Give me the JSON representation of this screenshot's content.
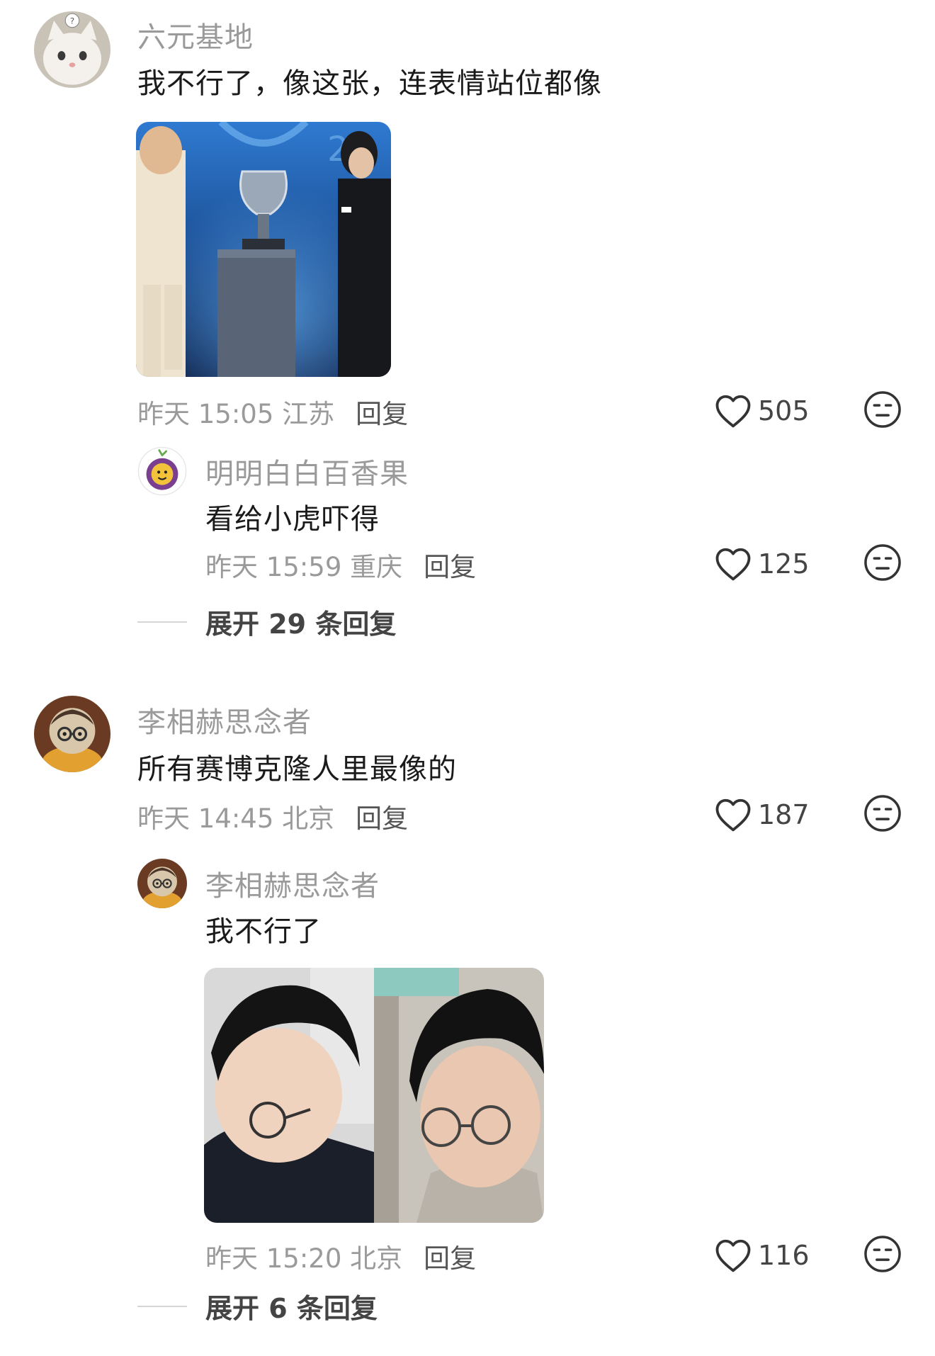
{
  "comments": [
    {
      "username": "六元基地",
      "text": "我不行了，像这张，连表情站位都像",
      "time": "昨天 15:05 江苏",
      "reply_label": "回复",
      "likes": "505",
      "avatar_icon": "cat-avatar-icon",
      "image": "trophy-stage-photo",
      "replies": [
        {
          "username": "明明白白百香果",
          "text": "看给小虎吓得",
          "time": "昨天 15:59 重庆",
          "reply_label": "回复",
          "likes": "125",
          "avatar_icon": "passion-fruit-avatar-icon"
        }
      ],
      "expand_label": "展开 29 条回复"
    },
    {
      "username": "李相赫思念者",
      "text": "所有赛博克隆人里最像的",
      "time": "昨天 14:45 北京",
      "reply_label": "回复",
      "likes": "187",
      "avatar_icon": "plush-doll-avatar-icon",
      "replies": [
        {
          "username": "李相赫思念者",
          "text": "我不行了",
          "time": "昨天 15:20 北京",
          "reply_label": "回复",
          "likes": "116",
          "avatar_icon": "plush-doll-avatar-icon",
          "image": "side-by-side-faces-photo"
        }
      ],
      "expand_label": "展开 6 条回复"
    }
  ],
  "colors": {
    "text_primary": "#1a1a1a",
    "text_secondary": "#9a9a9a",
    "icon": "#333333"
  }
}
